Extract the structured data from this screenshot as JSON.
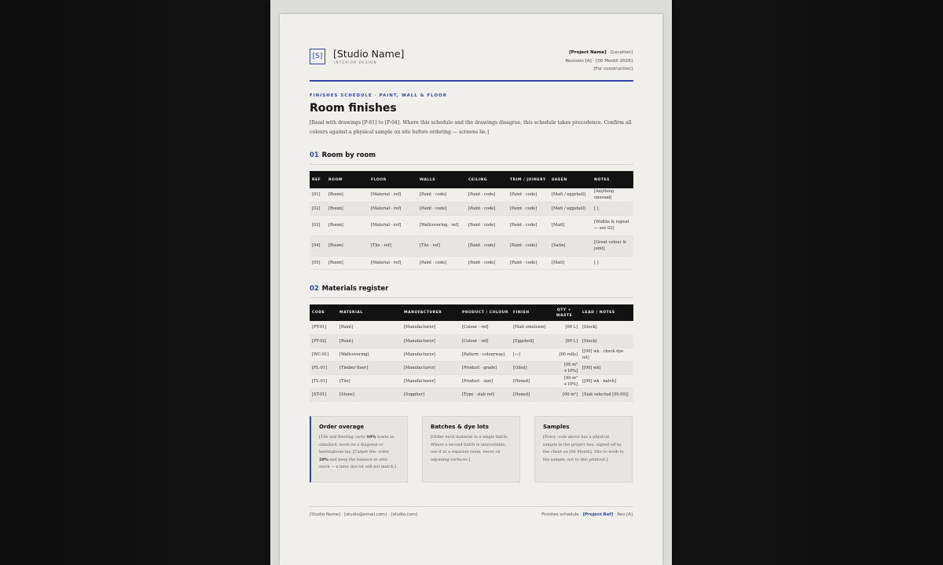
{
  "header": {
    "logo_mark": "[S]",
    "studio_name": "[Studio Name]",
    "studio_sub": "INTERIOR DESIGN",
    "project_name": "[Project Name]",
    "location": " · [Location]",
    "revision": "Revision [A] · [00 Month 2026]",
    "status": "[For construction]"
  },
  "doc": {
    "eyebrow": "FINISHES SCHEDULE · PAINT, WALL & FLOOR",
    "title": "Room finishes",
    "intro": "[Read with drawings [P-01] to [P-04]. Where this schedule and the drawings disagree, this schedule takes precedence. Confirm all colours against a physical sample on site before ordering — screens lie.]"
  },
  "section1": {
    "num": "01",
    "title": "Room by room",
    "columns": [
      "REF",
      "ROOM",
      "FLOOR",
      "WALLS",
      "CEILING",
      "TRIM / JOINERY",
      "SHEEN",
      "NOTES"
    ],
    "rows": [
      [
        "[01]",
        "[Room]",
        "[Material · ref]",
        "[Paint · code]",
        "[Paint · code]",
        "[Paint · code]",
        "[Matt / eggshell]",
        "[Anything unusual]"
      ],
      [
        "[02]",
        "[Room]",
        "[Material · ref]",
        "[Paint · code]",
        "[Paint · code]",
        "[Paint · code]",
        "[Matt / eggshell]",
        "[ ]"
      ],
      [
        "[03]",
        "[Room]",
        "[Material · ref]",
        "[Wallcovering · ref]",
        "[Paint · code]",
        "[Paint · code]",
        "[Matt]",
        "[Widths & repeat — see 02]"
      ],
      [
        "[04]",
        "[Room]",
        "[Tile · ref]",
        "[Tile · ref]",
        "[Paint · code]",
        "[Paint · code]",
        "[Satin]",
        "[Grout colour & joint]"
      ],
      [
        "[05]",
        "[Room]",
        "[Material · ref]",
        "[Paint · code]",
        "[Paint · code]",
        "[Paint · code]",
        "[Matt]",
        "[ ]"
      ]
    ]
  },
  "section2": {
    "num": "02",
    "title": "Materials register",
    "columns": [
      "CODE",
      "MATERIAL",
      "MANUFACTURER",
      "PRODUCT / COLOUR",
      "FINISH",
      "QTY + WASTE",
      "LEAD / NOTES"
    ],
    "rows": [
      [
        "[PT-01]",
        "[Paint]",
        "[Manufacturer]",
        "[Colour · ref]",
        "[Matt emulsion]",
        "[00 L]",
        "[Stock]"
      ],
      [
        "[PT-02]",
        "[Paint]",
        "[Manufacturer]",
        "[Colour · ref]",
        "[Eggshell]",
        "[00 L]",
        "[Stock]"
      ],
      [
        "[WC-01]",
        "[Wallcovering]",
        "[Manufacturer]",
        "[Pattern · colourway]",
        "[—]",
        "[00 rolls]",
        "[[00] wk · check dye lot]"
      ],
      [
        "[FL-01]",
        "[Timber floor]",
        "[Manufacturer]",
        "[Product · grade]",
        "[Oiled]",
        "[00 m² +10%]",
        "[[00] wk]"
      ],
      [
        "[TL-01]",
        "[Tile]",
        "[Manufacturer]",
        "[Product · size]",
        "[Honed]",
        "[00 m² +10%]",
        "[[00] wk · batch]"
      ],
      [
        "[ST-01]",
        "[Stone]",
        "[Supplier]",
        "[Type · slab ref]",
        "[Honed]",
        "[00 m²]",
        "[Slab selected [00.00]]"
      ]
    ]
  },
  "callouts": [
    {
      "title": "Order overage",
      "pre": "[Tile and flooring carry ",
      "b1": "10%",
      "mid": " waste as standard, more on a diagonal or herringbone lay. [Carpet tile: order ",
      "b2": "20%",
      "post": " and keep the balance as attic stock — a later dye lot will not match.]"
    },
    {
      "title": "Batches & dye lots",
      "body": "[Order each material in a single batch. Where a second batch is unavoidable, use it in a separate room, never on adjoining surfaces.]"
    },
    {
      "title": "Samples",
      "body": "[Every code above has a physical sample in the project box, signed off by the client on [00 Month]. Site to work to the sample, not to this printout.]"
    }
  ],
  "footer": {
    "left": "[Studio Name] · [studio@email.com] · [studio.com]",
    "right_pre": "Finishes schedule · ",
    "right_ref": "[Project Ref]",
    "right_post": " · Rev [A]"
  }
}
